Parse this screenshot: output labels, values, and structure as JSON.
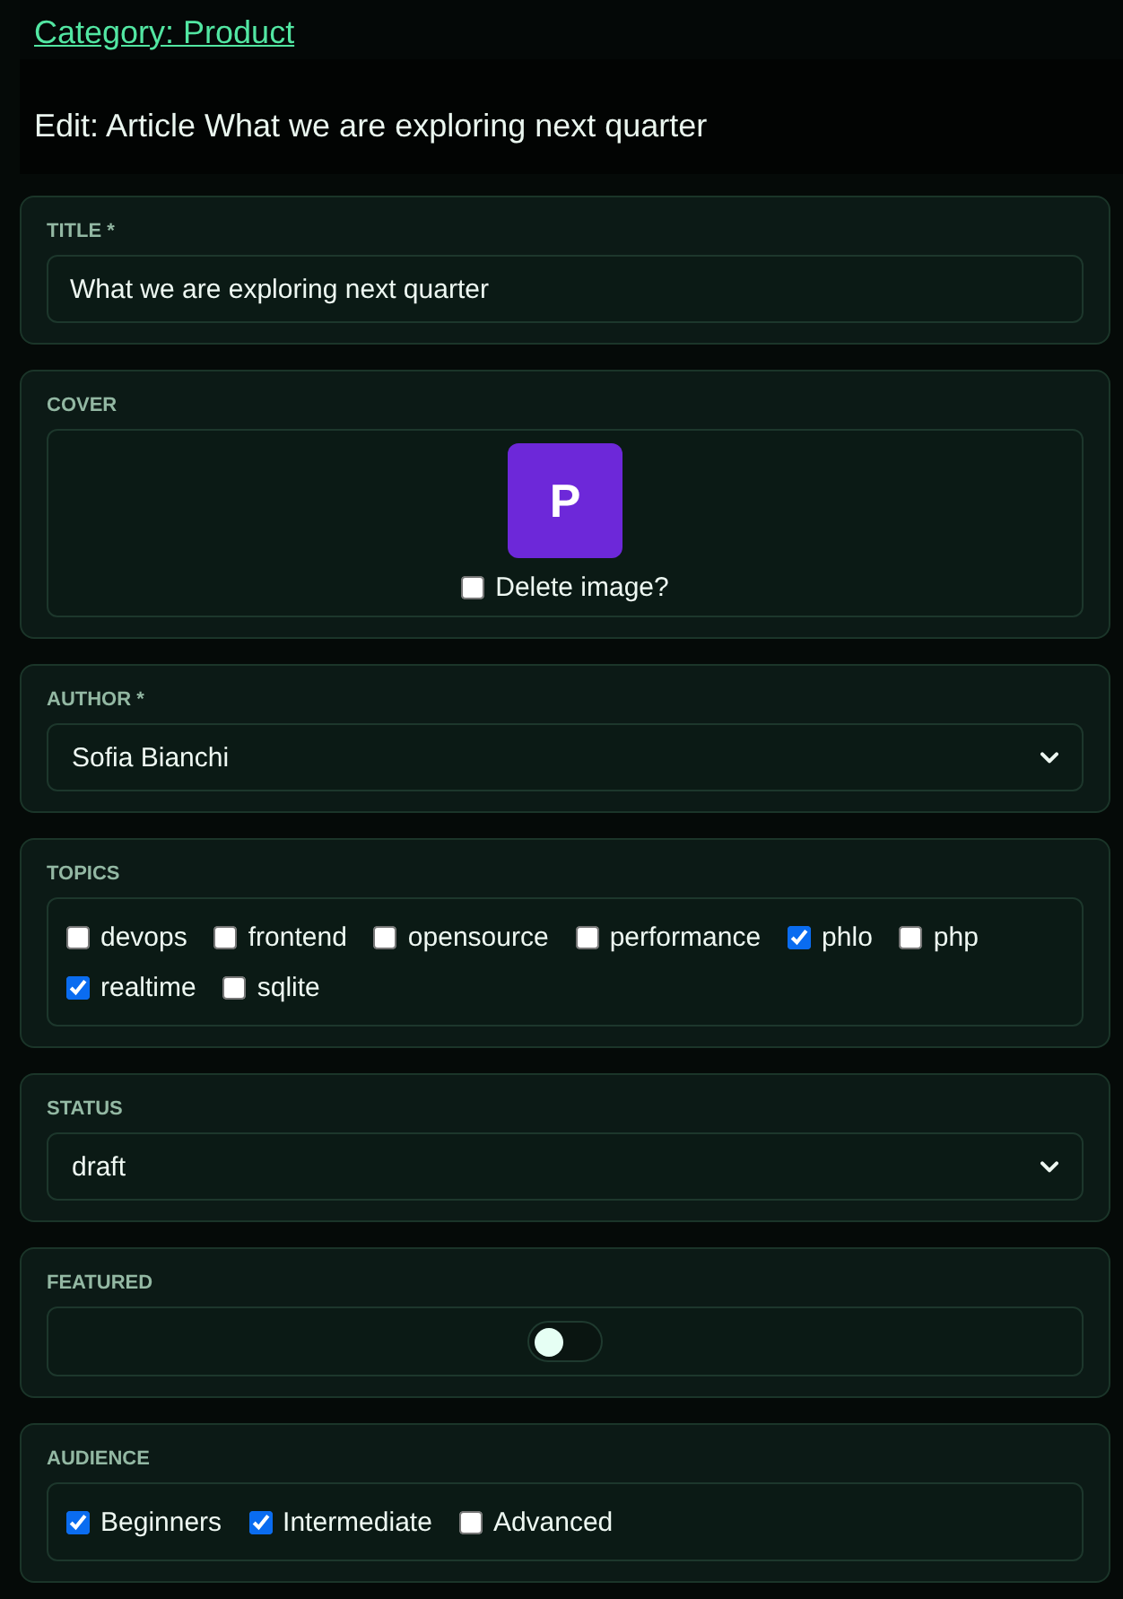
{
  "breadcrumb": {
    "link": "Category: Product"
  },
  "heading": "Edit: Article What we are exploring next quarter",
  "fields": [
    {
      "kind": "text",
      "label": "TITLE *",
      "value": "What we are exploring next quarter"
    },
    {
      "kind": "image",
      "label": "COVER",
      "image": {
        "letter": "P"
      },
      "delete": {
        "label": "Delete image?",
        "checked": false
      }
    },
    {
      "kind": "select",
      "label": "AUTHOR *",
      "value": "Sofia Bianchi"
    },
    {
      "kind": "checkboxes",
      "label": "TOPICS",
      "options": [
        {
          "label": "devops",
          "checked": false
        },
        {
          "label": "frontend",
          "checked": false
        },
        {
          "label": "opensource",
          "checked": false
        },
        {
          "label": "performance",
          "checked": false
        },
        {
          "label": "phlo",
          "checked": true
        },
        {
          "label": "php",
          "checked": false
        },
        {
          "label": "realtime",
          "checked": true
        },
        {
          "label": "sqlite",
          "checked": false
        }
      ]
    },
    {
      "kind": "select",
      "label": "STATUS",
      "value": "draft"
    },
    {
      "kind": "toggle",
      "label": "FEATURED",
      "on": false
    },
    {
      "kind": "checkboxes",
      "label": "AUDIENCE",
      "options": [
        {
          "label": "Beginners",
          "checked": true
        },
        {
          "label": "Intermediate",
          "checked": true
        },
        {
          "label": "Advanced",
          "checked": false
        }
      ]
    }
  ]
}
